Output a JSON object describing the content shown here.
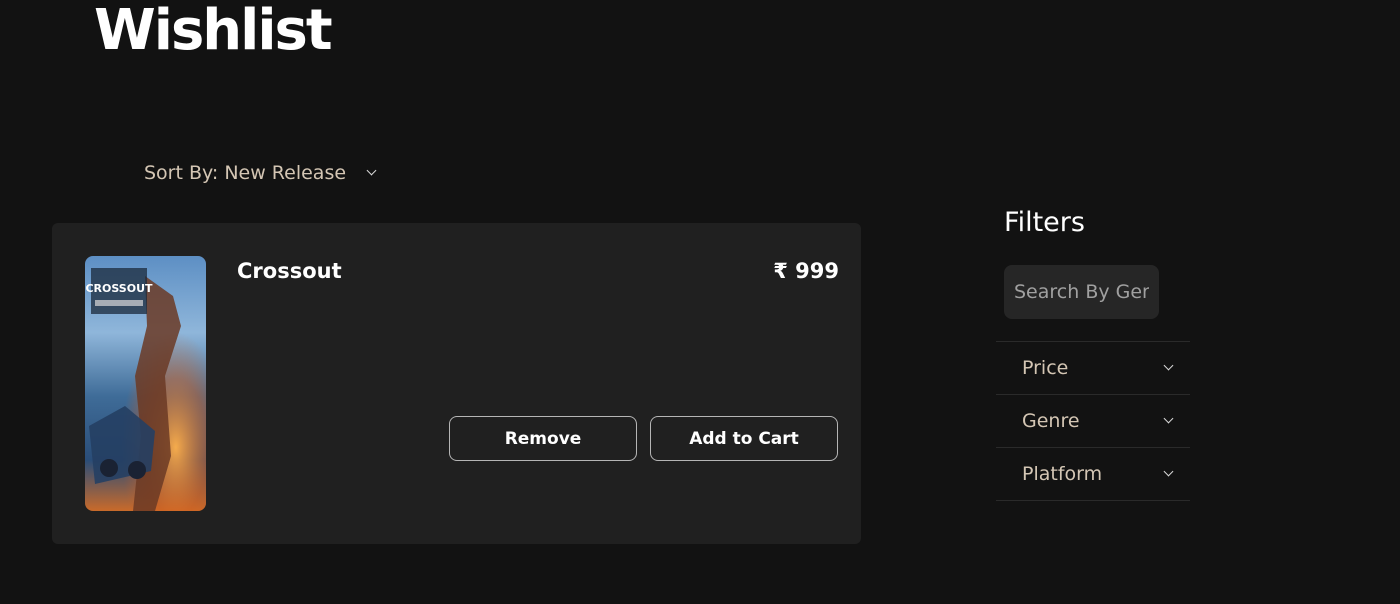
{
  "page": {
    "title": "Wishlist"
  },
  "sort": {
    "label": "Sort By: New Release",
    "icon": "chevron-down-icon"
  },
  "wishlist": {
    "items": [
      {
        "name": "Crossout",
        "price": "₹ 999",
        "cover_logo": "CROSSOUT",
        "remove_label": "Remove",
        "add_to_cart_label": "Add to Cart"
      }
    ]
  },
  "filters": {
    "heading": "Filters",
    "search_placeholder": "Search By Genre",
    "items": [
      {
        "label": "Price",
        "icon": "chevron-down-icon"
      },
      {
        "label": "Genre",
        "icon": "chevron-down-icon"
      },
      {
        "label": "Platform",
        "icon": "chevron-down-icon"
      }
    ]
  },
  "colors": {
    "background": "#121212",
    "card": "#202020",
    "muted_label": "#d4c6b4",
    "button_border": "#b5b5b5"
  }
}
